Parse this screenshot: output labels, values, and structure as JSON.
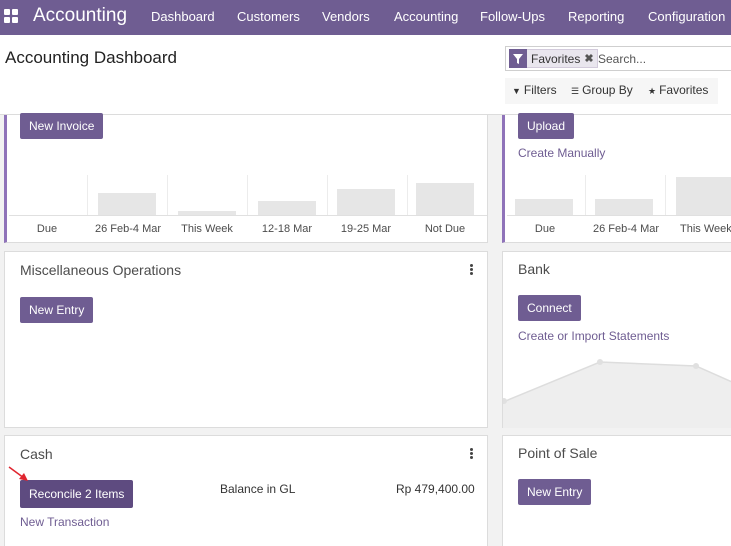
{
  "navbar": {
    "brand": "Accounting",
    "menu": [
      "Dashboard",
      "Customers",
      "Vendors",
      "Accounting",
      "Follow-Ups",
      "Reporting",
      "Configuration"
    ]
  },
  "control_panel": {
    "title": "Accounting Dashboard",
    "facet": "Favorites",
    "search_placeholder": "Search...",
    "filters_label": "Filters",
    "group_by_label": "Group By",
    "favorites_label": "Favorites"
  },
  "cards": {
    "sales": {
      "button": "New Invoice",
      "graph_labels": [
        "Due",
        "26 Feb-4 Mar",
        "This Week",
        "12-18 Mar",
        "19-25 Mar",
        "Not Due"
      ]
    },
    "purchases": {
      "button": "Upload",
      "link": "Create Manually",
      "graph_labels": [
        "Due",
        "26 Feb-4 Mar",
        "This Week"
      ]
    },
    "misc": {
      "title": "Miscellaneous Operations",
      "button": "New Entry"
    },
    "bank": {
      "title": "Bank",
      "button": "Connect",
      "link": "Create or Import Statements"
    },
    "cash": {
      "title": "Cash",
      "button": "Reconcile 2 Items",
      "link": "New Transaction",
      "balance_label": "Balance in GL",
      "balance_value": "Rp 479,400.00"
    },
    "pos": {
      "title": "Point of Sale",
      "button": "New Entry"
    }
  },
  "colors": {
    "brand": "#6f5d92",
    "accent": "#8f73b9",
    "annotation_arrow": "#e0252f"
  }
}
